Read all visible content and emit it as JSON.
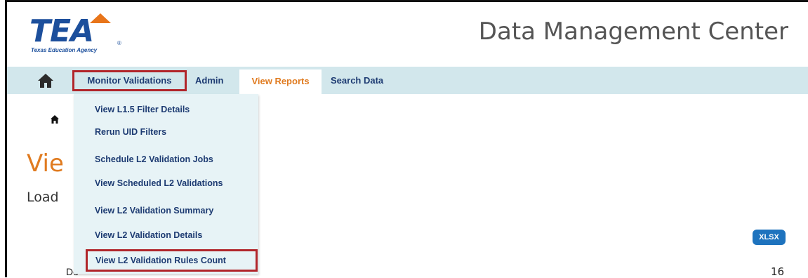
{
  "header": {
    "logo_text": "TEA",
    "logo_subtitle": "Texas Education Agency",
    "app_title": "Data Management Center"
  },
  "nav": {
    "home_icon": "home-icon",
    "items": [
      {
        "label": "Monitor Validations",
        "highlighted": true
      },
      {
        "label": "Admin"
      },
      {
        "label": "View Reports",
        "active": true
      },
      {
        "label": "Search Data"
      }
    ]
  },
  "dropdown": {
    "items": [
      {
        "label": "View L1.5 Filter Details"
      },
      {
        "label": "Rerun UID Filters"
      },
      {
        "label": "Schedule L2 Validation Jobs"
      },
      {
        "label": "View Scheduled L2 Validations"
      },
      {
        "label": "View L2 Validation Summary"
      },
      {
        "label": "View L2 Validation Details"
      },
      {
        "label": "View L2 Validation Rules Count",
        "highlighted": true
      }
    ]
  },
  "page": {
    "breadcrumb_icon": "home-icon",
    "title_partial": "Vie",
    "load_partial": "Load",
    "export_button": "XLSX",
    "row_label_partial": "Do",
    "row_value": "16"
  },
  "colors": {
    "nav_bg": "#d2e7ec",
    "dropdown_bg": "#e7f3f6",
    "nav_text": "#1d3b72",
    "accent_orange": "#e07b20",
    "highlight_red": "#b1252a",
    "button_blue": "#1e73be"
  }
}
